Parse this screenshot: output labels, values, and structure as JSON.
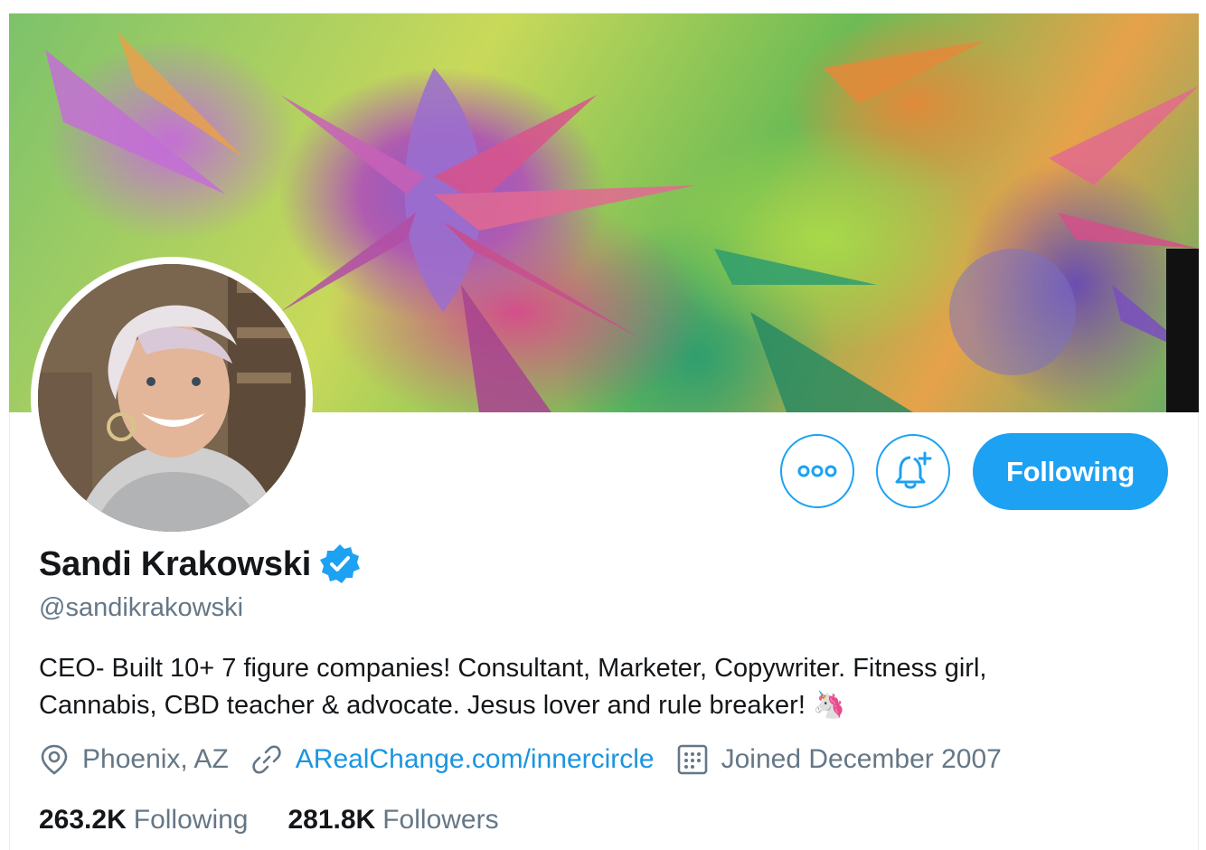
{
  "profile": {
    "name": "Sandi Krakowski",
    "handle": "@sandikrakowski",
    "bio": "CEO- Built 10+ 7 figure companies! Consultant, Marketer, Copywriter. Fitness girl,",
    "bio_line2": "Cannabis, CBD teacher & advocate. Jesus lover and rule breaker!",
    "bio_emoji": "🦄",
    "verified": true
  },
  "meta": {
    "location": "Phoenix, AZ",
    "website": "ARealChange.com/innercircle",
    "joined": "Joined December 2007"
  },
  "stats": {
    "following_count": "263.2K",
    "following_label": "Following",
    "followers_count": "281.8K",
    "followers_label": "Followers"
  },
  "actions": {
    "following_button": "Following"
  },
  "icons": {
    "more": "more-icon",
    "notifications": "bell-plus-icon",
    "verified": "verified-badge-icon",
    "location": "location-pin-icon",
    "link": "link-icon",
    "calendar": "calendar-icon"
  },
  "colors": {
    "accent": "#1da1f2",
    "link": "#1b95e0",
    "secondary_text": "#657786"
  }
}
